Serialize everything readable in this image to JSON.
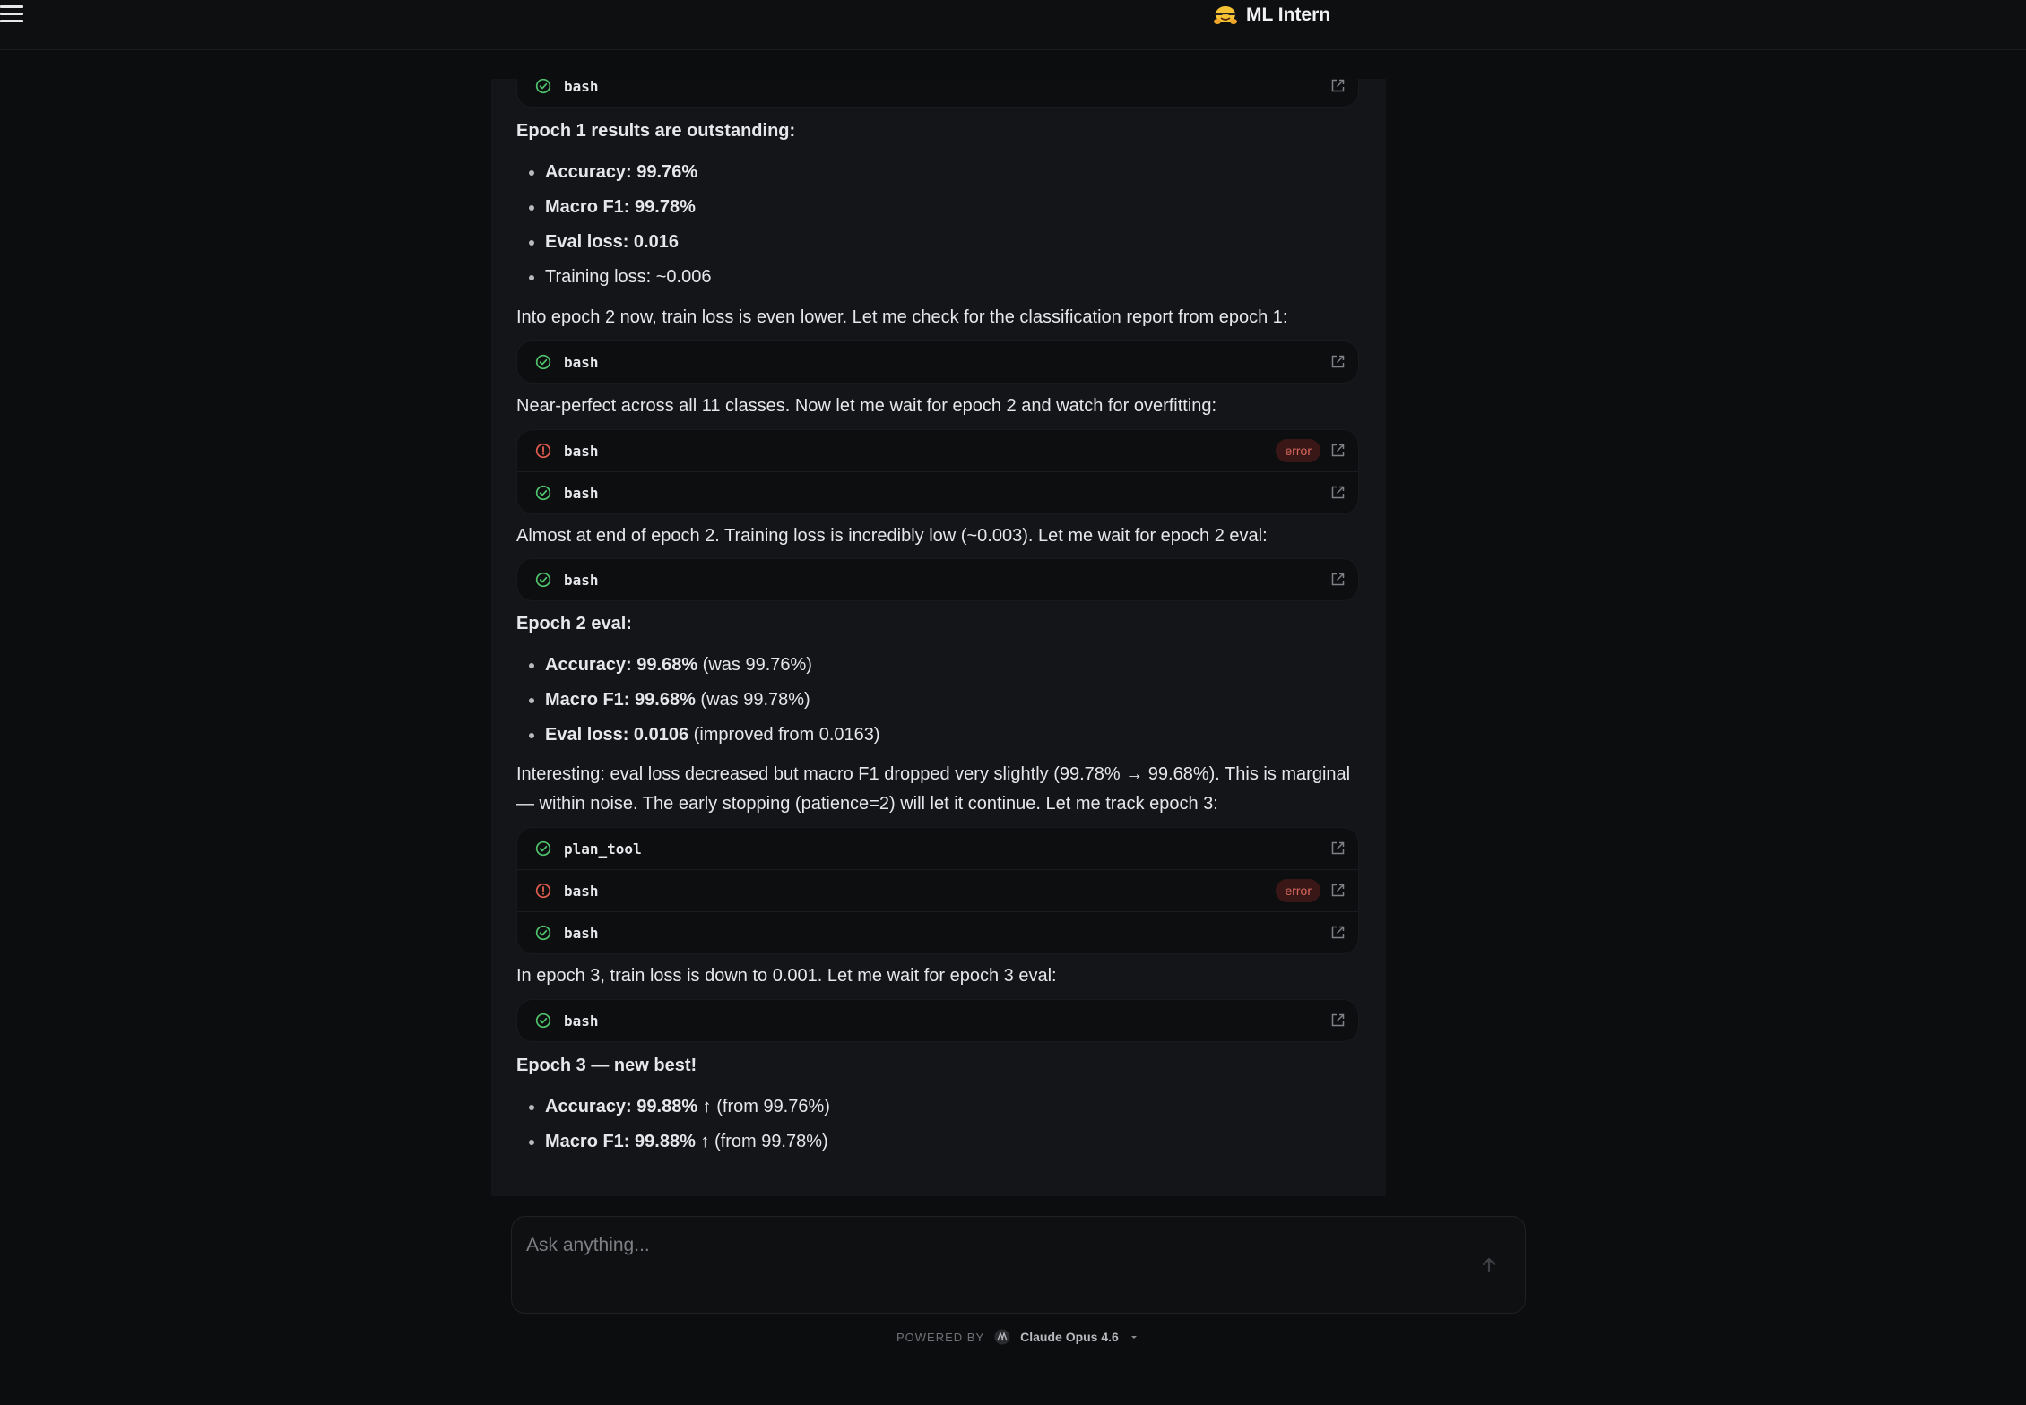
{
  "app": {
    "title": "ML Intern"
  },
  "colors": {
    "ok": "#4fc36b",
    "error": "#e25c4f",
    "bg": "#0c0d0f",
    "panel": "#141518",
    "card": "#0d0e10"
  },
  "messages": {
    "g1": [
      {
        "status": "ok",
        "name": "bash"
      }
    ],
    "t1": "Epoch 1 results are outstanding:",
    "l1": [
      {
        "b": "Accuracy: 99.76%",
        "r": ""
      },
      {
        "b": "Macro F1: 99.78%",
        "r": ""
      },
      {
        "b": "Eval loss: 0.016",
        "r": ""
      },
      {
        "b": "",
        "r": "Training loss: ~0.006"
      }
    ],
    "t2": "Into epoch 2 now, train loss is even lower. Let me check for the classification report from epoch 1:",
    "g2": [
      {
        "status": "ok",
        "name": "bash"
      }
    ],
    "t3": "Near-perfect across all 11 classes. Now let me wait for epoch 2 and watch for overfitting:",
    "g3": [
      {
        "status": "error",
        "name": "bash",
        "badge": "error"
      },
      {
        "status": "ok",
        "name": "bash"
      }
    ],
    "t4": "Almost at end of epoch 2. Training loss is incredibly low (~0.003). Let me wait for epoch 2 eval:",
    "g4": [
      {
        "status": "ok",
        "name": "bash"
      }
    ],
    "t5": "Epoch 2 eval:",
    "l2": [
      {
        "b": "Accuracy: 99.68%",
        "r": " (was 99.76%)"
      },
      {
        "b": "Macro F1: 99.68%",
        "r": " (was 99.78%)"
      },
      {
        "b": "Eval loss: 0.0106",
        "r": " (improved from 0.0163)"
      }
    ],
    "t6": "Interesting: eval loss decreased but macro F1 dropped very slightly (99.78% → 99.68%). This is marginal — within noise. The early stopping (patience=2) will let it continue. Let me track epoch 3:",
    "g5": [
      {
        "status": "ok",
        "name": "plan_tool"
      },
      {
        "status": "error",
        "name": "bash",
        "badge": "error"
      },
      {
        "status": "ok",
        "name": "bash"
      }
    ],
    "t7": "In epoch 3, train loss is down to 0.001. Let me wait for epoch 3 eval:",
    "g6": [
      {
        "status": "ok",
        "name": "bash"
      }
    ],
    "t8": "Epoch 3 — new best!",
    "l3": [
      {
        "b": "Accuracy: 99.88%",
        "r": " ↑ (from 99.76%)"
      },
      {
        "b": "Macro F1: 99.88%",
        "r": " ↑ (from 99.78%)"
      }
    ]
  },
  "composer": {
    "placeholder": "Ask anything..."
  },
  "footer": {
    "powered_by": "POWERED BY",
    "model": "Claude Opus 4.6"
  },
  "icons": {
    "menu": "hamburger-menu-icon",
    "logo": "hugging-face-logo-icon",
    "ok": "check-circle-icon",
    "error": "alert-circle-icon",
    "open": "external-link-icon",
    "send": "arrow-up-icon",
    "model": "anthropic-logo-icon",
    "dropdown": "chevron-down-icon"
  }
}
